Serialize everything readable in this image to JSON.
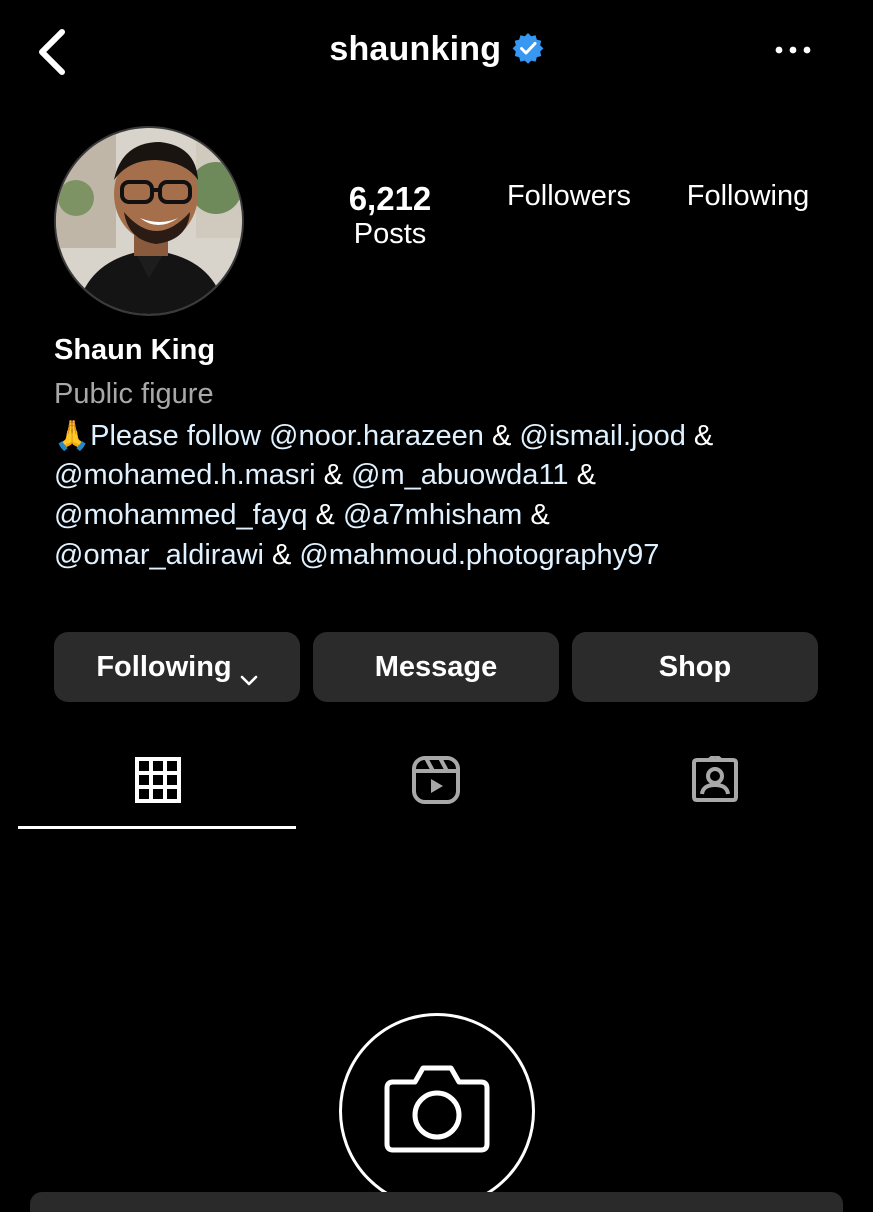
{
  "header": {
    "username": "shaunking",
    "verified": true,
    "icons": {
      "back": "back-chevron-icon",
      "verified": "verified-badge-icon",
      "more": "more-options-icon"
    },
    "verified_color": "#3897f0"
  },
  "profile": {
    "stats": [
      {
        "value": "6,212",
        "label": "Posts"
      },
      {
        "value": "",
        "label": "Followers"
      },
      {
        "value": "",
        "label": "Following"
      }
    ],
    "name": "Shaun King",
    "category": "Public figure",
    "bio_emoji": "🙏",
    "bio_lines": [
      [
        {
          "t": "Please follow ",
          "c": "text"
        },
        {
          "t": "@noor.harazeen",
          "c": "mention"
        },
        {
          "t": " & ",
          "c": "amp"
        },
        {
          "t": "@ismail.jood",
          "c": "mention"
        },
        {
          "t": " &",
          "c": "amp"
        }
      ],
      [
        {
          "t": "@mohamed.h.masri",
          "c": "mention"
        },
        {
          "t": " & ",
          "c": "amp"
        },
        {
          "t": "@m_abuowda11",
          "c": "mention"
        },
        {
          "t": " &",
          "c": "amp"
        }
      ],
      [
        {
          "t": "@mohammed_fayq",
          "c": "mention"
        },
        {
          "t": " & ",
          "c": "amp"
        },
        {
          "t": "@a7mhisham",
          "c": "mention"
        },
        {
          "t": " &",
          "c": "amp"
        }
      ],
      [
        {
          "t": "@omar_aldirawi",
          "c": "mention"
        },
        {
          "t": " & ",
          "c": "amp"
        },
        {
          "t": "@mahmoud.photography97",
          "c": "mention"
        }
      ]
    ],
    "mention_color": "#e0f1ff"
  },
  "actions": {
    "following_label": "Following",
    "message_label": "Message",
    "shop_label": "Shop",
    "button_bg": "#2b2b2b"
  },
  "tabs": [
    {
      "name": "grid",
      "icon": "grid-icon",
      "active": true
    },
    {
      "name": "reels",
      "icon": "reels-icon",
      "active": false
    },
    {
      "name": "tagged",
      "icon": "tagged-icon",
      "active": false
    }
  ],
  "empty_state": {
    "icon": "camera-icon"
  }
}
